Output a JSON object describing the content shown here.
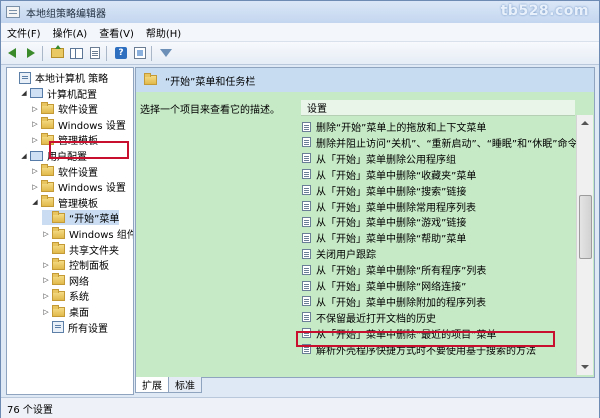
{
  "window": {
    "title": "本地组策略编辑器",
    "watermark": "tb528.com"
  },
  "menu": [
    "文件(F)",
    "操作(A)",
    "查看(V)",
    "帮助(H)"
  ],
  "tree": {
    "items": [
      {
        "label": "本地计算机 策略",
        "depth": 0,
        "expander": "",
        "icon": "policy"
      },
      {
        "label": "计算机配置",
        "depth": 1,
        "expander": "◢",
        "icon": "computer"
      },
      {
        "label": "软件设置",
        "depth": 2,
        "expander": "▷",
        "icon": "folder"
      },
      {
        "label": "Windows 设置",
        "depth": 2,
        "expander": "▷",
        "icon": "folder"
      },
      {
        "label": "管理模板",
        "depth": 2,
        "expander": "▷",
        "icon": "folder"
      },
      {
        "label": "用户配置",
        "depth": 1,
        "expander": "◢",
        "icon": "computer"
      },
      {
        "label": "软件设置",
        "depth": 2,
        "expander": "▷",
        "icon": "folder"
      },
      {
        "label": "Windows 设置",
        "depth": 2,
        "expander": "▷",
        "icon": "folder"
      },
      {
        "label": "管理模板",
        "depth": 2,
        "expander": "◢",
        "icon": "folder"
      },
      {
        "label": "“开始”菜单",
        "depth": 3,
        "expander": "",
        "icon": "folder"
      },
      {
        "label": "Windows 组件",
        "depth": 3,
        "expander": "▷",
        "icon": "folder"
      },
      {
        "label": "共享文件夹",
        "depth": 3,
        "expander": "",
        "icon": "folder"
      },
      {
        "label": "控制面板",
        "depth": 3,
        "expander": "▷",
        "icon": "folder"
      },
      {
        "label": "网络",
        "depth": 3,
        "expander": "▷",
        "icon": "folder"
      },
      {
        "label": "系统",
        "depth": 3,
        "expander": "▷",
        "icon": "folder"
      },
      {
        "label": "桌面",
        "depth": 3,
        "expander": "▷",
        "icon": "folder"
      },
      {
        "label": "所有设置",
        "depth": 3,
        "expander": "",
        "icon": "policy"
      }
    ]
  },
  "right": {
    "header_title": "“开始”菜单和任务栏",
    "description": "选择一个项目来查看它的描述。",
    "list_header": "设置",
    "settings": [
      "删除“开始”菜单上的拖放和上下文菜单",
      "删除并阻止访问“关机”、“重新启动”、“睡眠”和“休眠”命令",
      "从「开始」菜单删除公用程序组",
      "从「开始」菜单中删除“收藏夹”菜单",
      "从「开始」菜单中删除“搜索”链接",
      "从「开始」菜单中删除常用程序列表",
      "从「开始」菜单中删除“游戏”链接",
      "从「开始」菜单中删除“帮助”菜单",
      "关闭用户跟踪",
      "从「开始」菜单中删除“所有程序”列表",
      "从「开始」菜单中删除“网络连接”",
      "从「开始」菜单中删除附加的程序列表",
      "不保留最近打开文档的历史",
      "从「开始」菜单中删除“最近的项目”菜单",
      "解析外壳程序快捷方式时不要使用基于搜索的方法"
    ]
  },
  "tabs": [
    "扩展",
    "标准"
  ],
  "status": {
    "text": "76 个设置"
  },
  "colors": {
    "highlight_red": "#c8102e",
    "pane_green": "#c6e9c6",
    "header_blue": "#c7dcf1"
  }
}
